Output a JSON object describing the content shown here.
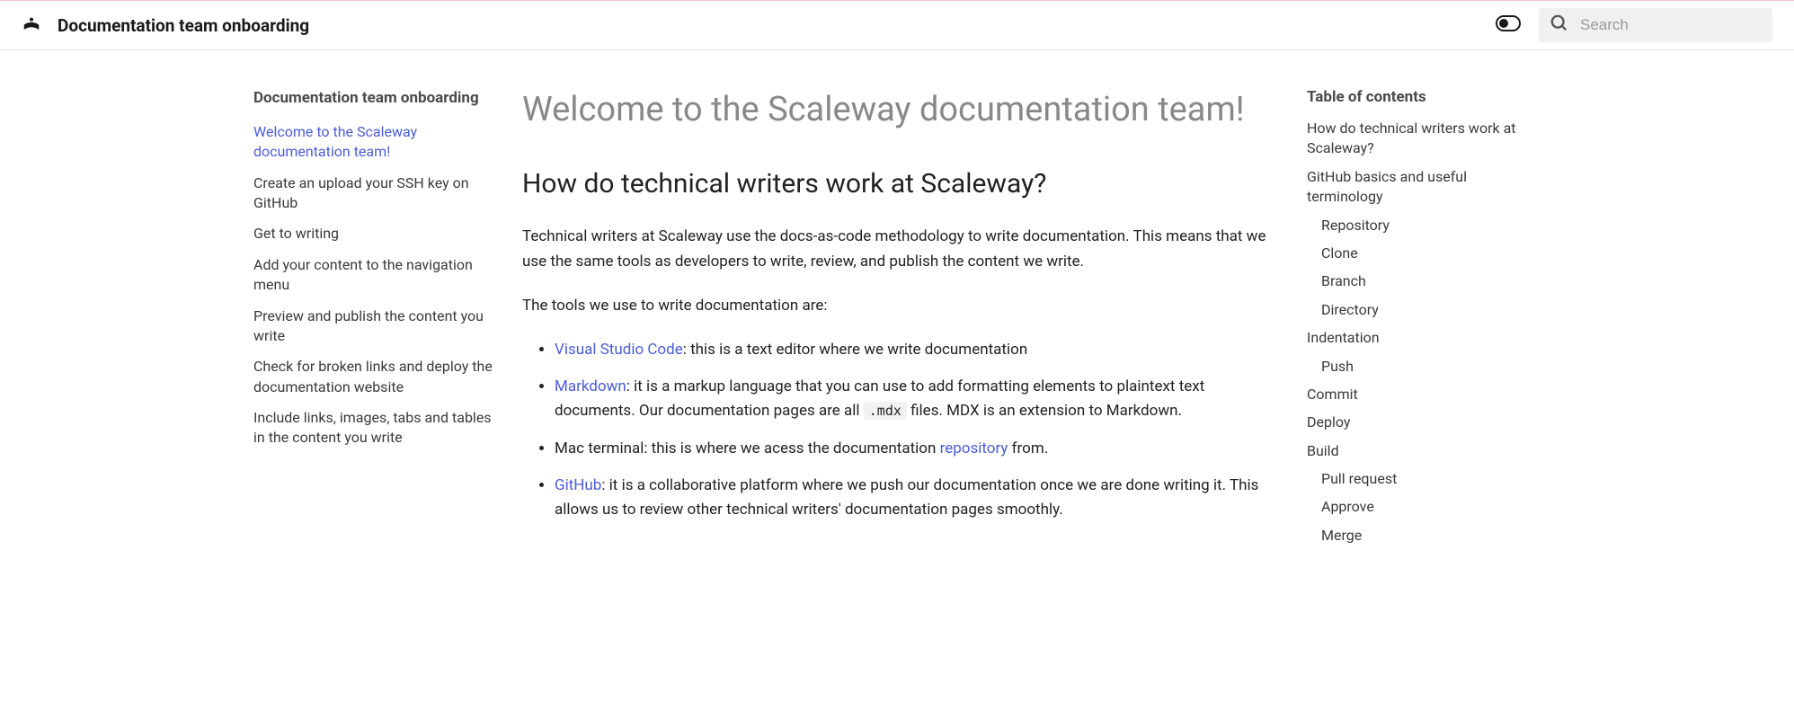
{
  "header": {
    "site_title": "Documentation team onboarding",
    "search_placeholder": "Search"
  },
  "sidebar": {
    "title": "Documentation team onboarding",
    "items": [
      {
        "label": "Welcome to the Scaleway documentation team!",
        "active": true
      },
      {
        "label": "Create an upload your SSH key on GitHub",
        "active": false
      },
      {
        "label": "Get to writing",
        "active": false
      },
      {
        "label": "Add your content to the navigation menu",
        "active": false
      },
      {
        "label": "Preview and publish the content you write",
        "active": false
      },
      {
        "label": "Check for broken links and deploy the documentation website",
        "active": false
      },
      {
        "label": "Include links, images, tabs and tables in the content you write",
        "active": false
      }
    ]
  },
  "content": {
    "h1": "Welcome to the Scaleway documentation team!",
    "h2": "How do technical writers work at Scaleway?",
    "p1": "Technical writers at Scaleway use the docs-as-code methodology to write documentation. This means that we use the same tools as developers to write, review, and publish the content we write.",
    "p2": "The tools we use to write documentation are:",
    "tools": {
      "vscode_link": "Visual Studio Code",
      "vscode_rest": ": this is a text editor where we write documentation",
      "markdown_link": "Markdown",
      "markdown_rest_a": ": it is a markup language that you can use to add formatting elements to plaintext text documents. Our documentation pages are all ",
      "markdown_code": ".mdx",
      "markdown_rest_b": " files. MDX is an extension to Markdown.",
      "terminal_a": "Mac terminal: this is where we acess the documentation ",
      "terminal_link": "repository",
      "terminal_b": " from.",
      "github_link": "GitHub",
      "github_rest": ": it is a collaborative platform where we push our documentation once we are done writing it. This allows us to review other technical writers' documentation pages smoothly."
    }
  },
  "toc": {
    "title": "Table of contents",
    "items": [
      {
        "label": "How do technical writers work at Scaleway?",
        "sub": false
      },
      {
        "label": "GitHub basics and useful terminology",
        "sub": false
      },
      {
        "label": "Repository",
        "sub": true
      },
      {
        "label": "Clone",
        "sub": true
      },
      {
        "label": "Branch",
        "sub": true
      },
      {
        "label": "Directory",
        "sub": true
      },
      {
        "label": "Indentation",
        "sub": false
      },
      {
        "label": "Push",
        "sub": true
      },
      {
        "label": "Commit",
        "sub": false
      },
      {
        "label": "Deploy",
        "sub": false
      },
      {
        "label": "Build",
        "sub": false
      },
      {
        "label": "Pull request",
        "sub": true
      },
      {
        "label": "Approve",
        "sub": true
      },
      {
        "label": "Merge",
        "sub": true
      }
    ]
  }
}
